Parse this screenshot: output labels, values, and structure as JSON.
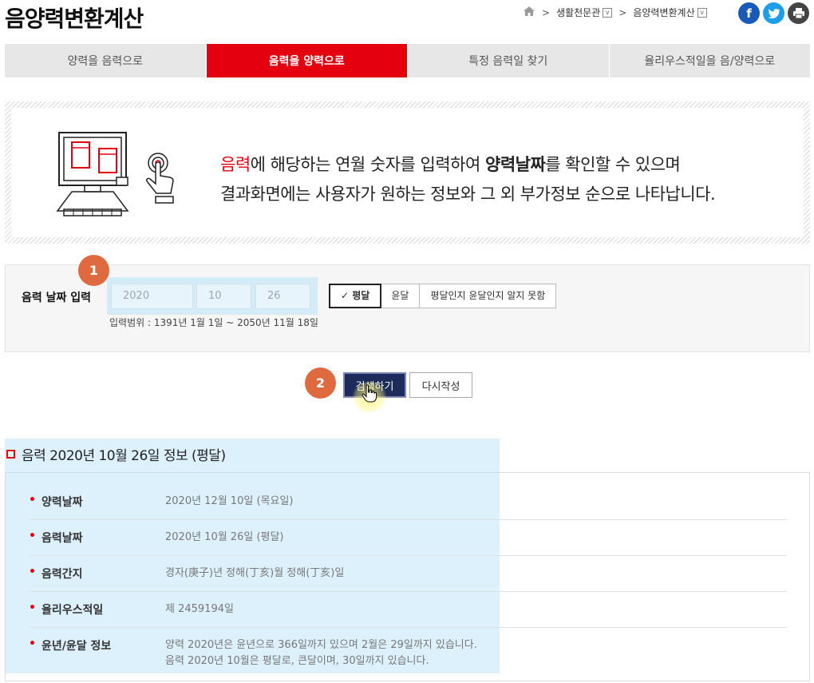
{
  "page": {
    "title": "음양력변환계산"
  },
  "breadcrumb": {
    "items": [
      "생활천문관",
      "음양력변환계산"
    ]
  },
  "social": {
    "facebook": "f",
    "twitter": "t",
    "print": "⎙"
  },
  "tabs": [
    {
      "label": "양력을 음력으로",
      "active": false
    },
    {
      "label": "음력을 양력으로",
      "active": true
    },
    {
      "label": "특정 음력일 찾기",
      "active": false
    },
    {
      "label": "율리우스적일을 음/양력으로",
      "active": false
    }
  ],
  "intro": {
    "line1_red": "음력",
    "line1_a": "에 해당하는 연월 숫자를 입력하여 ",
    "line1_bold": "양력날짜",
    "line1_b": "를 확인할 수 있으며",
    "line2": "결과화면에는 사용자가 원하는 정보와 그 외 부가정보 순으로 나타납니다."
  },
  "form": {
    "label": "음력 날짜 입력",
    "year": "2020",
    "month": "10",
    "day": "26",
    "options": [
      "평달",
      "윤달",
      "평달인지 윤달인지 알지 못함"
    ],
    "selected": "평달",
    "range": "입력범위 : 1391년 1월 1일 ~ 2050년 11월 18일"
  },
  "steps": {
    "one": "1",
    "two": "2"
  },
  "buttons": {
    "search": "검색하기",
    "reset": "다시작성"
  },
  "result": {
    "title": "음력 2020년 10월 26일 정보 (평달)",
    "rows": [
      {
        "key": "양력날짜",
        "value": "2020년 12월 10일 (목요일)"
      },
      {
        "key": "음력날짜",
        "value": "2020년 10월 26일 (평달)"
      },
      {
        "key": "음력간지",
        "value": "경자(庚子)년 정해(丁亥)월 정해(丁亥)일"
      },
      {
        "key": "율리우스적일",
        "value": "제 2459194일"
      },
      {
        "key": "윤년/윤달 정보",
        "value": "양력 2020년은 윤년으로 366일까지 있으며 2월은 29일까지 있습니다.",
        "value2": "음력 2020년 10월은 평달로, 큰달이며, 30일까지 있습니다."
      }
    ]
  }
}
